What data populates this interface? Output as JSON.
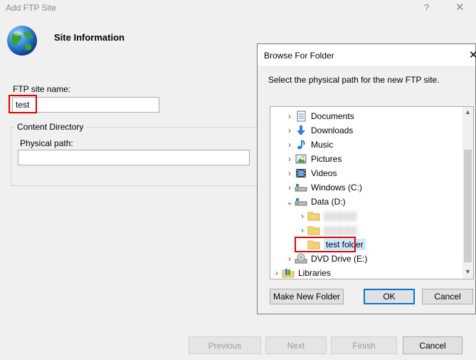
{
  "window": {
    "title": "Add FTP Site",
    "help_glyph": "?",
    "close_glyph": "✕",
    "section_title": "Site Information"
  },
  "site": {
    "name_label": "FTP site name:",
    "name_value": "test",
    "content_directory_legend": "Content Directory",
    "physical_path_label": "Physical path:",
    "physical_path_value": ""
  },
  "wizard_buttons": {
    "previous": "Previous",
    "next": "Next",
    "finish": "Finish",
    "cancel": "Cancel"
  },
  "browse": {
    "title": "Browse For Folder",
    "close_glyph": "✕",
    "instruction": "Select the physical path for the new FTP site.",
    "tree": [
      {
        "label": "Documents",
        "icon": "documents-icon",
        "chevron": "›"
      },
      {
        "label": "Downloads",
        "icon": "downloads-icon",
        "chevron": "›"
      },
      {
        "label": "Music",
        "icon": "music-icon",
        "chevron": "›"
      },
      {
        "label": "Pictures",
        "icon": "pictures-icon",
        "chevron": "›"
      },
      {
        "label": "Videos",
        "icon": "videos-icon",
        "chevron": "›"
      },
      {
        "label": "Windows (C:)",
        "icon": "drive-icon",
        "chevron": "›"
      },
      {
        "label": "Data (D:)",
        "icon": "drive-icon",
        "chevron": "⌄"
      },
      {
        "label": "▒▒▒▒▒",
        "icon": "folder-icon",
        "chevron": "›"
      },
      {
        "label": "▒▒▒▒▒",
        "icon": "folder-icon",
        "chevron": "›"
      },
      {
        "label": "test folder",
        "icon": "folder-icon",
        "chevron": ""
      },
      {
        "label": "DVD Drive (E:)",
        "icon": "dvd-drive-icon",
        "chevron": "›"
      },
      {
        "label": "Libraries",
        "icon": "libraries-icon",
        "chevron": "›"
      }
    ],
    "buttons": {
      "make_new_folder": "Make New Folder",
      "ok": "OK",
      "cancel": "Cancel"
    }
  },
  "colors": {
    "highlight_red": "#e00000",
    "selection_blue": "#cce8ff",
    "ok_border": "#0078d7"
  }
}
